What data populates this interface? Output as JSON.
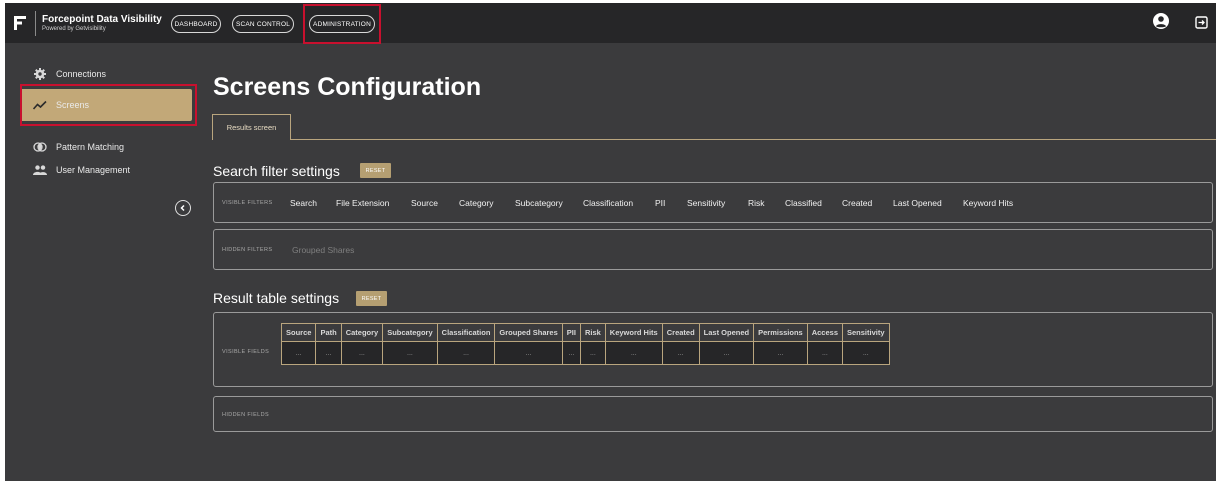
{
  "header": {
    "brand_title": "Forcepoint Data Visibility",
    "brand_subtitle": "Powered by Getvisibility",
    "nav": [
      {
        "label": "DASHBOARD"
      },
      {
        "label": "SCAN CONTROL"
      },
      {
        "label": "ADMINISTRATION",
        "highlighted": true
      }
    ],
    "icons": [
      "logo-icon",
      "user-account-icon",
      "logout-icon"
    ]
  },
  "sidebar": {
    "items": [
      {
        "label": "Connections",
        "icon": "gear-icon"
      },
      {
        "label": "Screens",
        "icon": "trend-line-icon",
        "active": true
      },
      {
        "label": "Pattern Matching",
        "icon": "overlap-circles-icon"
      },
      {
        "label": "User Management",
        "icon": "users-icon"
      }
    ]
  },
  "main": {
    "title": "Screens Configuration",
    "tabs": [
      {
        "label": "Results screen",
        "active": true
      }
    ],
    "search_filter": {
      "title": "Search filter settings",
      "reset_label": "RESET",
      "visible_label": "VISIBLE FILTERS",
      "visible": [
        "Search",
        "File Extension",
        "Source",
        "Category",
        "Subcategory",
        "Classification",
        "PII",
        "Sensitivity",
        "Risk",
        "Classified",
        "Created",
        "Last Opened",
        "Keyword Hits"
      ],
      "hidden_label": "HIDDEN FILTERS",
      "hidden": [
        "Grouped Shares"
      ]
    },
    "result_table": {
      "title": "Result table settings",
      "reset_label": "RESET",
      "visible_label": "VISIBLE FIELDS",
      "columns": [
        "Source",
        "Path",
        "Category",
        "Subcategory",
        "Classification",
        "Grouped Shares",
        "PII",
        "Risk",
        "Keyword Hits",
        "Created",
        "Last Opened",
        "Permissions",
        "Access",
        "Sensitivity"
      ],
      "placeholder": "...",
      "hidden_label": "HIDDEN FIELDS"
    }
  },
  "colors": {
    "background": "#3b3b3d",
    "topbar": "#262628",
    "accent_gold": "#c2a878",
    "highlight_red": "#c8102e"
  }
}
